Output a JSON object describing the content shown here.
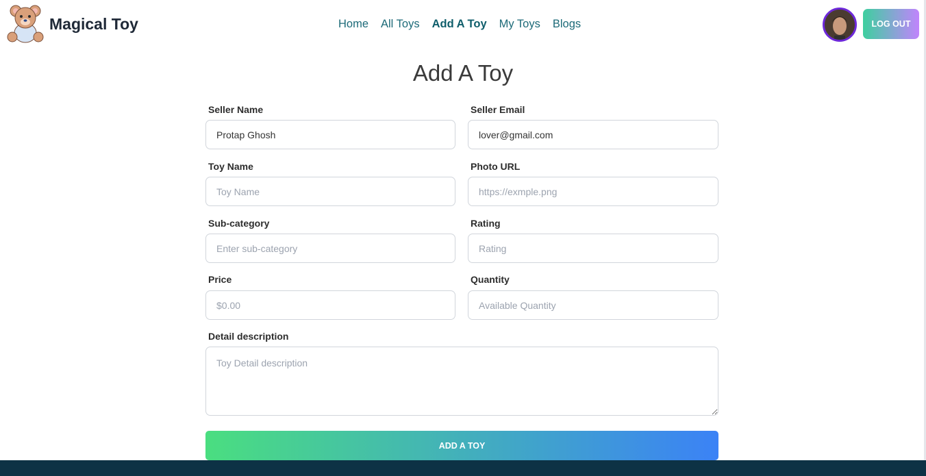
{
  "brand": {
    "name": "Magical Toy"
  },
  "nav": {
    "links": [
      {
        "label": "Home",
        "active": false
      },
      {
        "label": "All Toys",
        "active": false
      },
      {
        "label": "Add A Toy",
        "active": true
      },
      {
        "label": "My Toys",
        "active": false
      },
      {
        "label": "Blogs",
        "active": false
      }
    ],
    "logout_label": "LOG OUT"
  },
  "page": {
    "title": "Add A Toy"
  },
  "form": {
    "seller_name": {
      "label": "Seller Name",
      "value": "Protap Ghosh"
    },
    "seller_email": {
      "label": "Seller Email",
      "value": "lover@gmail.com"
    },
    "toy_name": {
      "label": "Toy Name",
      "placeholder": "Toy Name"
    },
    "photo_url": {
      "label": "Photo URL",
      "placeholder": "https://exmple.png"
    },
    "sub_category": {
      "label": "Sub-category",
      "placeholder": "Enter sub-category"
    },
    "rating": {
      "label": "Rating",
      "placeholder": "Rating"
    },
    "price": {
      "label": "Price",
      "placeholder": "$0.00"
    },
    "quantity": {
      "label": "Quantity",
      "placeholder": "Available Quantity"
    },
    "description": {
      "label": "Detail description",
      "placeholder": "Toy Detail description"
    },
    "submit_label": "ADD A TOY"
  },
  "colors": {
    "nav_link": "#1c6a78",
    "avatar_border": "#6d28d9",
    "footer": "#0d3245",
    "submit_gradient_start": "#4ade80",
    "submit_gradient_end": "#3b82f6"
  }
}
